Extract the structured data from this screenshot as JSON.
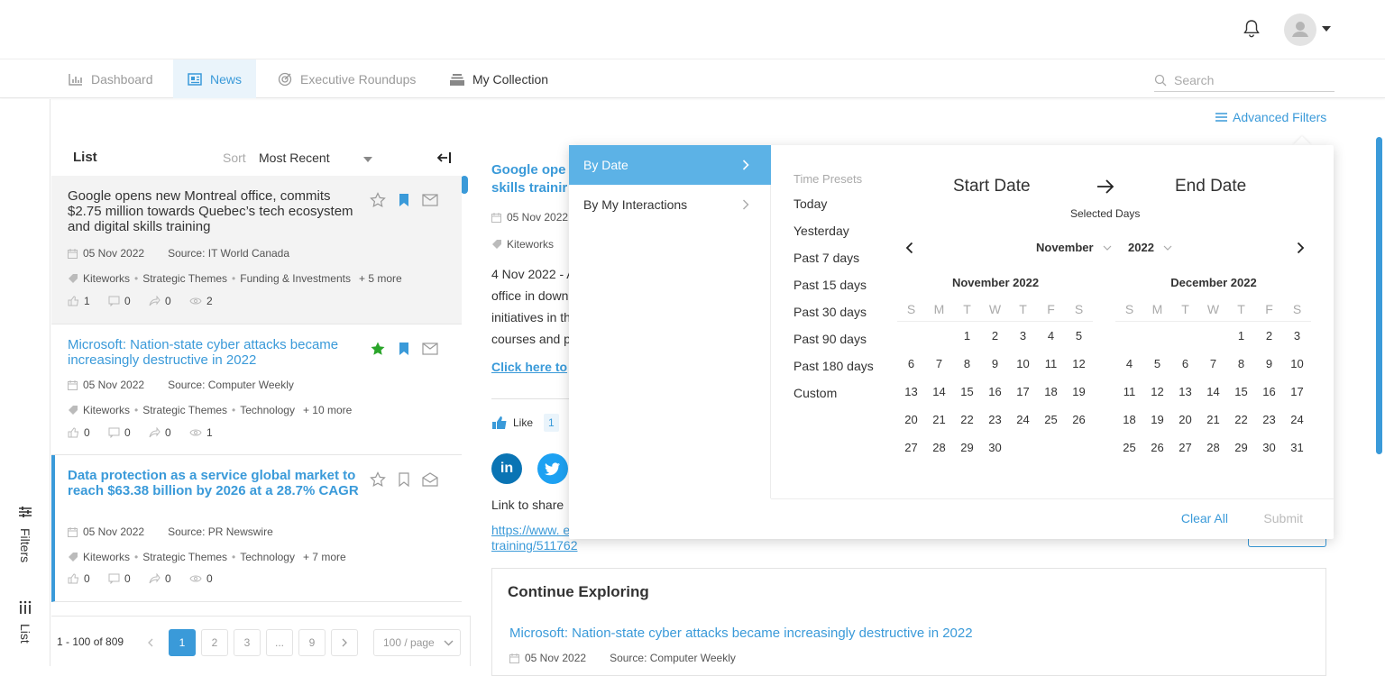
{
  "header": {
    "bell_icon": "bell-icon",
    "avatar_icon": "user-avatar-icon"
  },
  "nav": {
    "items": [
      {
        "label": "Dashboard",
        "icon": "bar-chart-icon"
      },
      {
        "label": "News",
        "icon": "newspaper-icon"
      },
      {
        "label": "Executive Roundups",
        "icon": "target-icon"
      },
      {
        "label": "My Collection",
        "icon": "stack-icon"
      }
    ],
    "search_placeholder": "Search"
  },
  "rail": {
    "filters_label": "Filters",
    "list_label": "List"
  },
  "advanced_filters_label": "Advanced Filters",
  "list": {
    "title": "List",
    "sort_label": "Sort",
    "sort_value": "Most Recent",
    "articles": [
      {
        "title": "Google opens new Montreal office, commits $2.75 million towards Quebec’s tech ecosystem and digital skills training",
        "date": "05 Nov 2022",
        "source": "Source: IT World Canada",
        "tags": [
          "Kiteworks",
          "Strategic Themes",
          "Funding & Investments"
        ],
        "more": "+ 5 more",
        "stats": [
          "1",
          "0",
          "0",
          "2"
        ]
      },
      {
        "title": "Microsoft: Nation-state cyber attacks became increasingly destructive in 2022",
        "date": "05 Nov 2022",
        "source": "Source: Computer Weekly",
        "tags": [
          "Kiteworks",
          "Strategic Themes",
          "Technology"
        ],
        "more": "+ 10 more",
        "stats": [
          "0",
          "0",
          "0",
          "1"
        ]
      },
      {
        "title": "Data protection as a service global market to reach $63.38 billion by 2026 at a 28.7% CAGR",
        "date": "05 Nov 2022",
        "source": "Source: PR Newswire",
        "tags": [
          "Kiteworks",
          "Strategic Themes",
          "Technology"
        ],
        "more": "+ 7 more",
        "stats": [
          "0",
          "0",
          "0",
          "0"
        ]
      }
    ]
  },
  "pagination": {
    "range": "1 - 100 of 809",
    "pages": [
      "1",
      "2",
      "3",
      "...",
      "9"
    ],
    "page_size": "100 / page"
  },
  "detail": {
    "title": "Google ope skills trainir",
    "date": "05 Nov 2022",
    "tag": "Kiteworks",
    "body": "4 Nov 2022 - A office in down initiatives in th courses and p",
    "link": "Click here to",
    "like_label": "Like",
    "like_count": "1",
    "share_label": "Link to share",
    "share_url": "https://www. ecosystem-and-digital-skills-training/511762",
    "explore_title": "Continue Exploring",
    "explore_link": "Microsoft: Nation-state cyber attacks became increasingly destructive in 2022",
    "explore_date": "05 Nov 2022",
    "explore_source": "Source: Computer Weekly"
  },
  "filter_popup": {
    "tabs": [
      "By Date",
      "By My Interactions"
    ],
    "presets_title": "Time Presets",
    "presets": [
      "Today",
      "Yesterday",
      "Past 7 days",
      "Past 15 days",
      "Past 30 days",
      "Past 90 days",
      "Past 180 days",
      "Custom"
    ],
    "start_label": "Start Date",
    "end_label": "End Date",
    "selected_days": "Selected Days",
    "month_select": "November",
    "year_select": "2022",
    "calendars": [
      {
        "title": "November 2022",
        "offset": 2,
        "days": 30
      },
      {
        "title": "December 2022",
        "offset": 4,
        "days": 31
      }
    ],
    "dow": [
      "S",
      "M",
      "T",
      "W",
      "T",
      "F",
      "S"
    ],
    "clear_all": "Clear All",
    "submit": "Submit"
  },
  "colors": {
    "accent": "#3a9ad9",
    "tab_active": "#5cb2e6",
    "star_green": "#2aa52a",
    "linkedin": "#0a74b4",
    "twitter": "#1da1f2"
  }
}
